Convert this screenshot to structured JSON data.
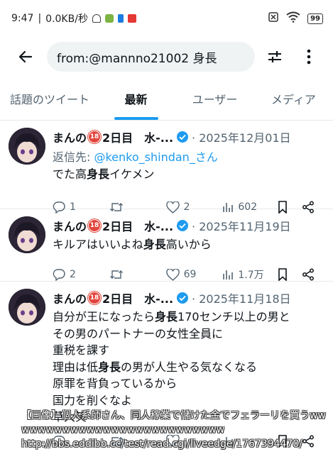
{
  "status_bar": {
    "time": "9:47",
    "speed": "0.0KB/秒",
    "battery": "99"
  },
  "search": {
    "query": "from:@mannno21002 身長"
  },
  "tabs": [
    {
      "label": "話題のツイート",
      "active": false
    },
    {
      "label": "最新",
      "active": true
    },
    {
      "label": "ユーザー",
      "active": false
    },
    {
      "label": "メディア",
      "active": false
    }
  ],
  "tweets": [
    {
      "name": "まんの",
      "badge": "18",
      "name_suffix": "2日目　水-...",
      "date": "· 2025年12月01日",
      "reply_prefix": "返信先: ",
      "reply_mention": "@kenko_shindan_さん",
      "text_parts": [
        "でた高",
        "身長",
        "イケメン"
      ],
      "replies": "1",
      "retweets": "",
      "likes": "2",
      "views": "602"
    },
    {
      "name": "まんの",
      "badge": "18",
      "name_suffix": "2日目　水-...",
      "date": "· 2025年11月19日",
      "text_parts": [
        "キルアはいいよね",
        "身長",
        "高いから"
      ],
      "replies": "2",
      "retweets": "",
      "likes": "69",
      "views": "1.7万"
    },
    {
      "name": "まんの",
      "badge": "18",
      "name_suffix": "2日目　水-...",
      "date": "· 2025年11月18日",
      "lines": [
        [
          "自分が王になったら",
          "身長",
          "170センチ以上の男と"
        ],
        [
          "その男のパートナーの女性全員に",
          "",
          ""
        ],
        [
          "重税を課す",
          "",
          ""
        ],
        [
          "理由は低",
          "身長",
          "の男が人生やる気なくなる"
        ],
        [
          "原罪を背負っているから",
          "",
          ""
        ],
        [
          "国力を削ぐなよ",
          "",
          ""
        ],
        [
          "草大笑",
          "",
          ""
        ]
      ]
    }
  ],
  "overlay": {
    "line1": "【画像】個人系師さん、同人稼業で儲けた金でフェラーリを買うww",
    "line2": "wwwwwwwwwwwwwwwwwwwwwwwww",
    "line3": "http://bbs.eddibb.cc/test/read.cgi/liveedge/1767394470/"
  },
  "colors": {
    "accent": "#1d9bf0",
    "text": "#0f1419",
    "muted": "#536471",
    "badge": "#e2453c"
  }
}
